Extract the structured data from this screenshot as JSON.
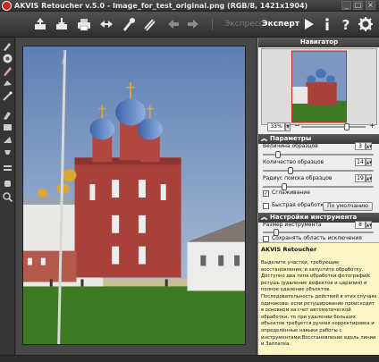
{
  "window": {
    "title": "AKVIS Retoucher v.5.0 - Image_for_test_original.png (RGB/8, 1421x1904)"
  },
  "toolbar": {
    "items": [
      {
        "name": "open",
        "icon": "open-icon"
      },
      {
        "name": "save",
        "icon": "save-icon"
      },
      {
        "name": "print",
        "icon": "print-icon"
      },
      {
        "name": "plugin",
        "icon": "plugin-icon"
      },
      {
        "name": "settings",
        "icon": "settings-icon"
      },
      {
        "name": "undo",
        "icon": "undo-icon"
      },
      {
        "name": "redo",
        "icon": "redo-icon"
      },
      {
        "name": "run",
        "icon": "run-icon"
      },
      {
        "name": "info",
        "icon": "info-icon"
      },
      {
        "name": "help",
        "icon": "help-icon"
      },
      {
        "name": "preferences",
        "icon": "preferences-icon"
      }
    ],
    "mode_express": "Экспресс",
    "mode_expert": "Эксперт"
  },
  "left_tools": [
    "brush-icon",
    "eraser-icon",
    "selection-brush-icon",
    "lasso-icon",
    "magic-wand-icon",
    "clone-stamp-icon",
    "patch-icon",
    "chameleon-brush-icon",
    "smudge-icon",
    "blur-icon",
    "hand-icon",
    "zoom-icon"
  ],
  "navigator": {
    "title": "Навигатор",
    "zoom": "33%",
    "zoom_level": 0.72
  },
  "params": {
    "title": "Параметры",
    "sample_size_label": "Величина образцов",
    "sample_size": "3",
    "sample_size_level": 0.12,
    "sample_count_label": "Количество образцов",
    "sample_count": "14",
    "sample_count_level": 0.24,
    "search_radius_label": "Радиус поиска образцов",
    "search_radius": "19",
    "search_radius_level": 0.18,
    "smoothing_label": "Сглаживание",
    "smoothing_checked": true,
    "fast_label": "Быстрая обработка",
    "fast_checked": false,
    "default_button": "По умолчанию"
  },
  "tool_settings": {
    "title": "Настройки инструмента",
    "size_label": "Размер инструмента",
    "size": "8",
    "size_level": 0.1,
    "keep_exclusion_label": "Сохранять область исключения",
    "keep_exclusion_checked": false
  },
  "help": {
    "title": "AKVIS Retoucher",
    "text": "Выделите участки, требующие восстановления, и запустите обработку. Доступно два типа обработки фотографий: ретушь (удаление дефектов и царапин) и полное удаление объектов. Последовательность действий в этих случаях одинакова: если ретуширование происходит в основном за счет автоматической обработки, то при удалении больших объектов требуется ручная корректировка и определённые навыки работы с инструментами:Восстановление вдоль линии и Заплатка."
  }
}
